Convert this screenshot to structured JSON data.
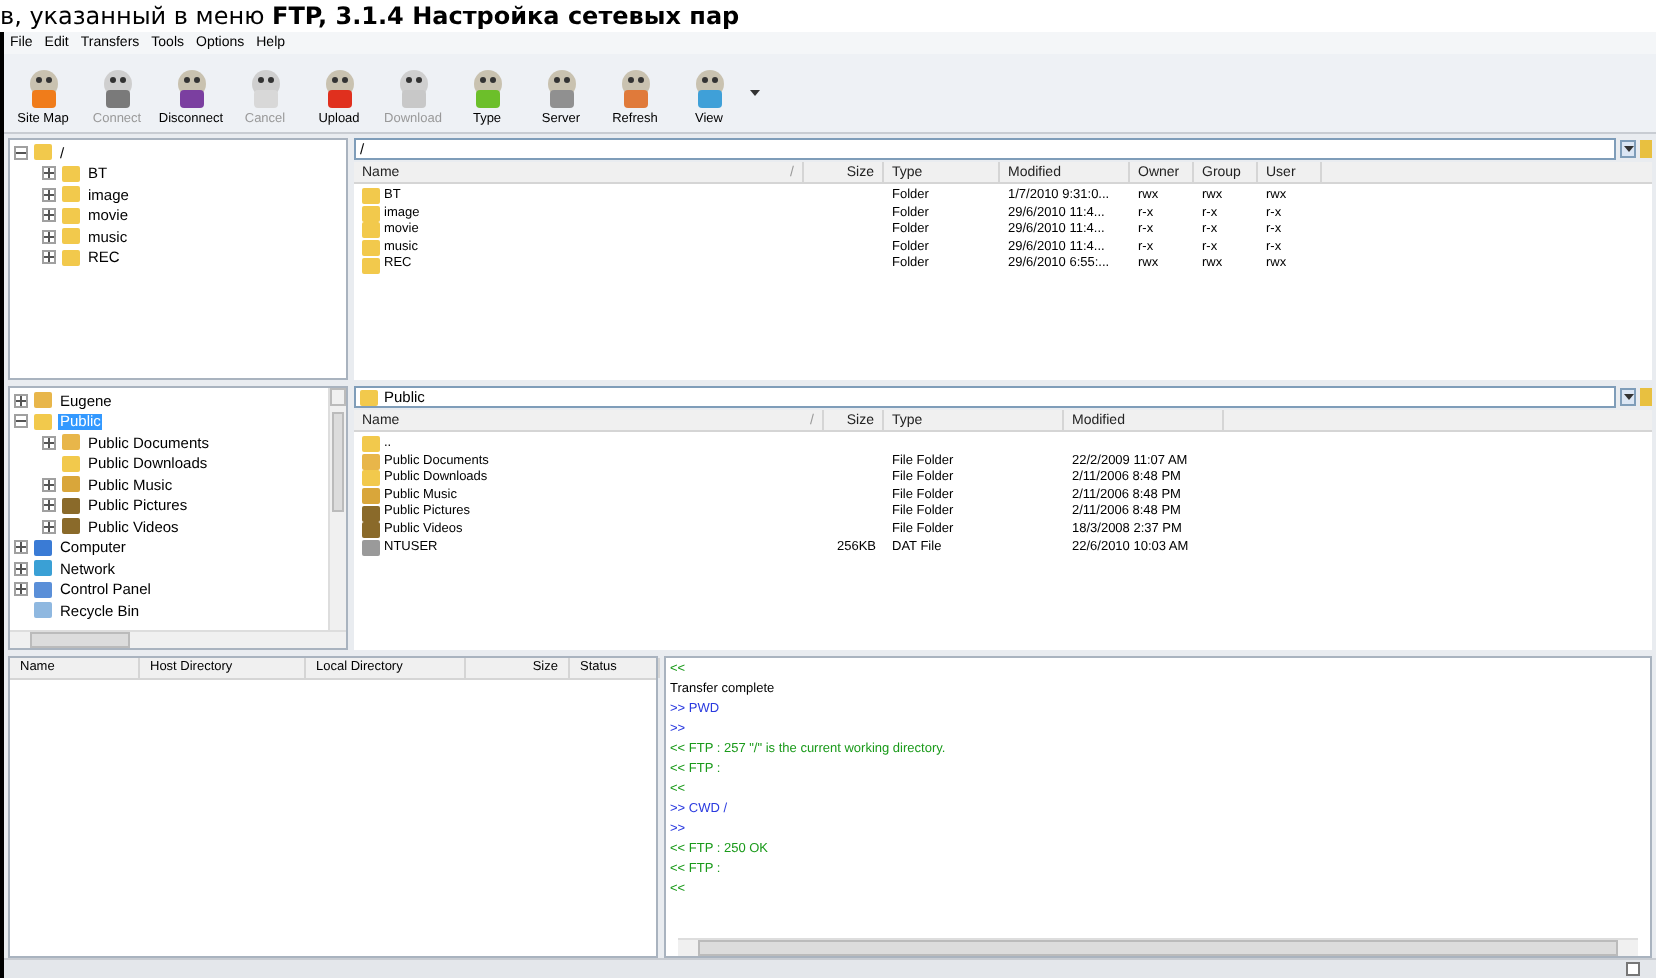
{
  "doc_heading": "в, указанный в меню **FTP, 3.1.4 Настройка сетевых пар**",
  "menu": [
    "File",
    "Edit",
    "Transfers",
    "Tools",
    "Options",
    "Help"
  ],
  "toolbar": [
    {
      "label": "Site Map",
      "disabled": false,
      "color": "#f07c1a"
    },
    {
      "label": "Connect",
      "disabled": true,
      "color": "#7a7a7a"
    },
    {
      "label": "Disconnect",
      "disabled": false,
      "color": "#7b3fa0"
    },
    {
      "label": "Cancel",
      "disabled": true,
      "color": "#d8d8d8"
    },
    {
      "label": "Upload",
      "disabled": false,
      "color": "#e0301e"
    },
    {
      "label": "Download",
      "disabled": true,
      "color": "#c8c8c8"
    },
    {
      "label": "Type",
      "disabled": false,
      "color": "#6cbf2a"
    },
    {
      "label": "Server",
      "disabled": false,
      "color": "#909090"
    },
    {
      "label": "Refresh",
      "disabled": false,
      "color": "#e07a3a"
    },
    {
      "label": "View",
      "disabled": false,
      "color": "#3fa0d8"
    }
  ],
  "remote_tree": [
    {
      "label": "/",
      "kind": "folder",
      "expanded": true,
      "selected": false,
      "children": [
        {
          "label": "BT",
          "kind": "folder",
          "expanded": false,
          "selected": false
        },
        {
          "label": "image",
          "kind": "folder",
          "expanded": false,
          "selected": false
        },
        {
          "label": "movie",
          "kind": "folder",
          "expanded": false,
          "selected": false
        },
        {
          "label": "music",
          "kind": "folder",
          "expanded": false,
          "selected": false
        },
        {
          "label": "REC",
          "kind": "folder",
          "expanded": false,
          "selected": false
        }
      ]
    }
  ],
  "remote_path": "/",
  "remote_table": {
    "columns": [
      {
        "label": "Name",
        "sort": "/"
      },
      {
        "label": "Size"
      },
      {
        "label": "Type"
      },
      {
        "label": "Modified"
      },
      {
        "label": "Owner"
      },
      {
        "label": "Group"
      },
      {
        "label": "User"
      }
    ],
    "rows": [
      {
        "kind": "folder",
        "cells": [
          "BT",
          "",
          "Folder",
          "1/7/2010 9:31:0...",
          "rwx",
          "rwx",
          "rwx"
        ]
      },
      {
        "kind": "folder",
        "cells": [
          "image",
          "",
          "Folder",
          "29/6/2010 11:4...",
          "r-x",
          "r-x",
          "r-x"
        ]
      },
      {
        "kind": "folder",
        "cells": [
          "movie",
          "",
          "Folder",
          "29/6/2010 11:4...",
          "r-x",
          "r-x",
          "r-x"
        ]
      },
      {
        "kind": "folder",
        "cells": [
          "music",
          "",
          "Folder",
          "29/6/2010 11:4...",
          "r-x",
          "r-x",
          "r-x"
        ]
      },
      {
        "kind": "folder",
        "cells": [
          "REC",
          "",
          "Folder",
          "29/6/2010 6:55:...",
          "rwx",
          "rwx",
          "rwx"
        ]
      }
    ]
  },
  "local_tree": [
    {
      "label": "Eugene",
      "kind": "user",
      "expanded": false,
      "selected": false
    },
    {
      "label": "Public",
      "kind": "folder",
      "expanded": true,
      "selected": true,
      "children": [
        {
          "label": "Public Documents",
          "kind": "user",
          "expanded": false,
          "selected": false
        },
        {
          "label": "Public Downloads",
          "kind": "folder",
          "selected": false
        },
        {
          "label": "Public Music",
          "kind": "music",
          "expanded": false,
          "selected": false
        },
        {
          "label": "Public Pictures",
          "kind": "pictures",
          "expanded": false,
          "selected": false
        },
        {
          "label": "Public Videos",
          "kind": "pictures",
          "expanded": false,
          "selected": false
        }
      ]
    },
    {
      "label": "Computer",
      "kind": "computer",
      "expanded": false,
      "selected": false
    },
    {
      "label": "Network",
      "kind": "network",
      "expanded": false,
      "selected": false
    },
    {
      "label": "Control Panel",
      "kind": "panel",
      "expanded": false,
      "selected": false
    },
    {
      "label": "Recycle Bin",
      "kind": "bin",
      "selected": false
    }
  ],
  "local_path": "Public",
  "local_table": {
    "columns": [
      {
        "label": "Name",
        "sort": "/"
      },
      {
        "label": "Size"
      },
      {
        "label": "Type"
      },
      {
        "label": "Modified"
      }
    ],
    "rows": [
      {
        "kind": "folder",
        "cells": [
          "..",
          "",
          "",
          ""
        ]
      },
      {
        "kind": "user",
        "cells": [
          "Public Documents",
          "",
          "File Folder",
          "22/2/2009 11:07 AM"
        ]
      },
      {
        "kind": "folder",
        "cells": [
          "Public Downloads",
          "",
          "File Folder",
          "2/11/2006 8:48 PM"
        ]
      },
      {
        "kind": "music",
        "cells": [
          "Public Music",
          "",
          "File Folder",
          "2/11/2006 8:48 PM"
        ]
      },
      {
        "kind": "pictures",
        "cells": [
          "Public Pictures",
          "",
          "File Folder",
          "2/11/2006 8:48 PM"
        ]
      },
      {
        "kind": "pictures",
        "cells": [
          "Public Videos",
          "",
          "File Folder",
          "18/3/2008 2:37 PM"
        ]
      },
      {
        "kind": "file",
        "cells": [
          "NTUSER",
          "256KB",
          "DAT File",
          "22/6/2010 10:03 AM"
        ]
      }
    ]
  },
  "queue_columns": [
    "Name",
    "Host Directory",
    "Local Directory",
    "Size",
    "Status"
  ],
  "log": [
    {
      "kind": "reply",
      "text": "<<"
    },
    {
      "kind": "info",
      "text": "Transfer complete"
    },
    {
      "kind": "command",
      "text": ">> PWD"
    },
    {
      "kind": "command",
      "text": ">>"
    },
    {
      "kind": "reply",
      "text": "<< FTP : 257 \"/\" is the current working directory."
    },
    {
      "kind": "reply",
      "text": "<< FTP :"
    },
    {
      "kind": "reply",
      "text": "<<"
    },
    {
      "kind": "command",
      "text": ">> CWD /"
    },
    {
      "kind": "command",
      "text": ">>"
    },
    {
      "kind": "reply",
      "text": "<< FTP : 250 OK"
    },
    {
      "kind": "reply",
      "text": "<< FTP :"
    },
    {
      "kind": "reply",
      "text": "<<"
    }
  ],
  "shutdown_option": {
    "checked": false
  }
}
